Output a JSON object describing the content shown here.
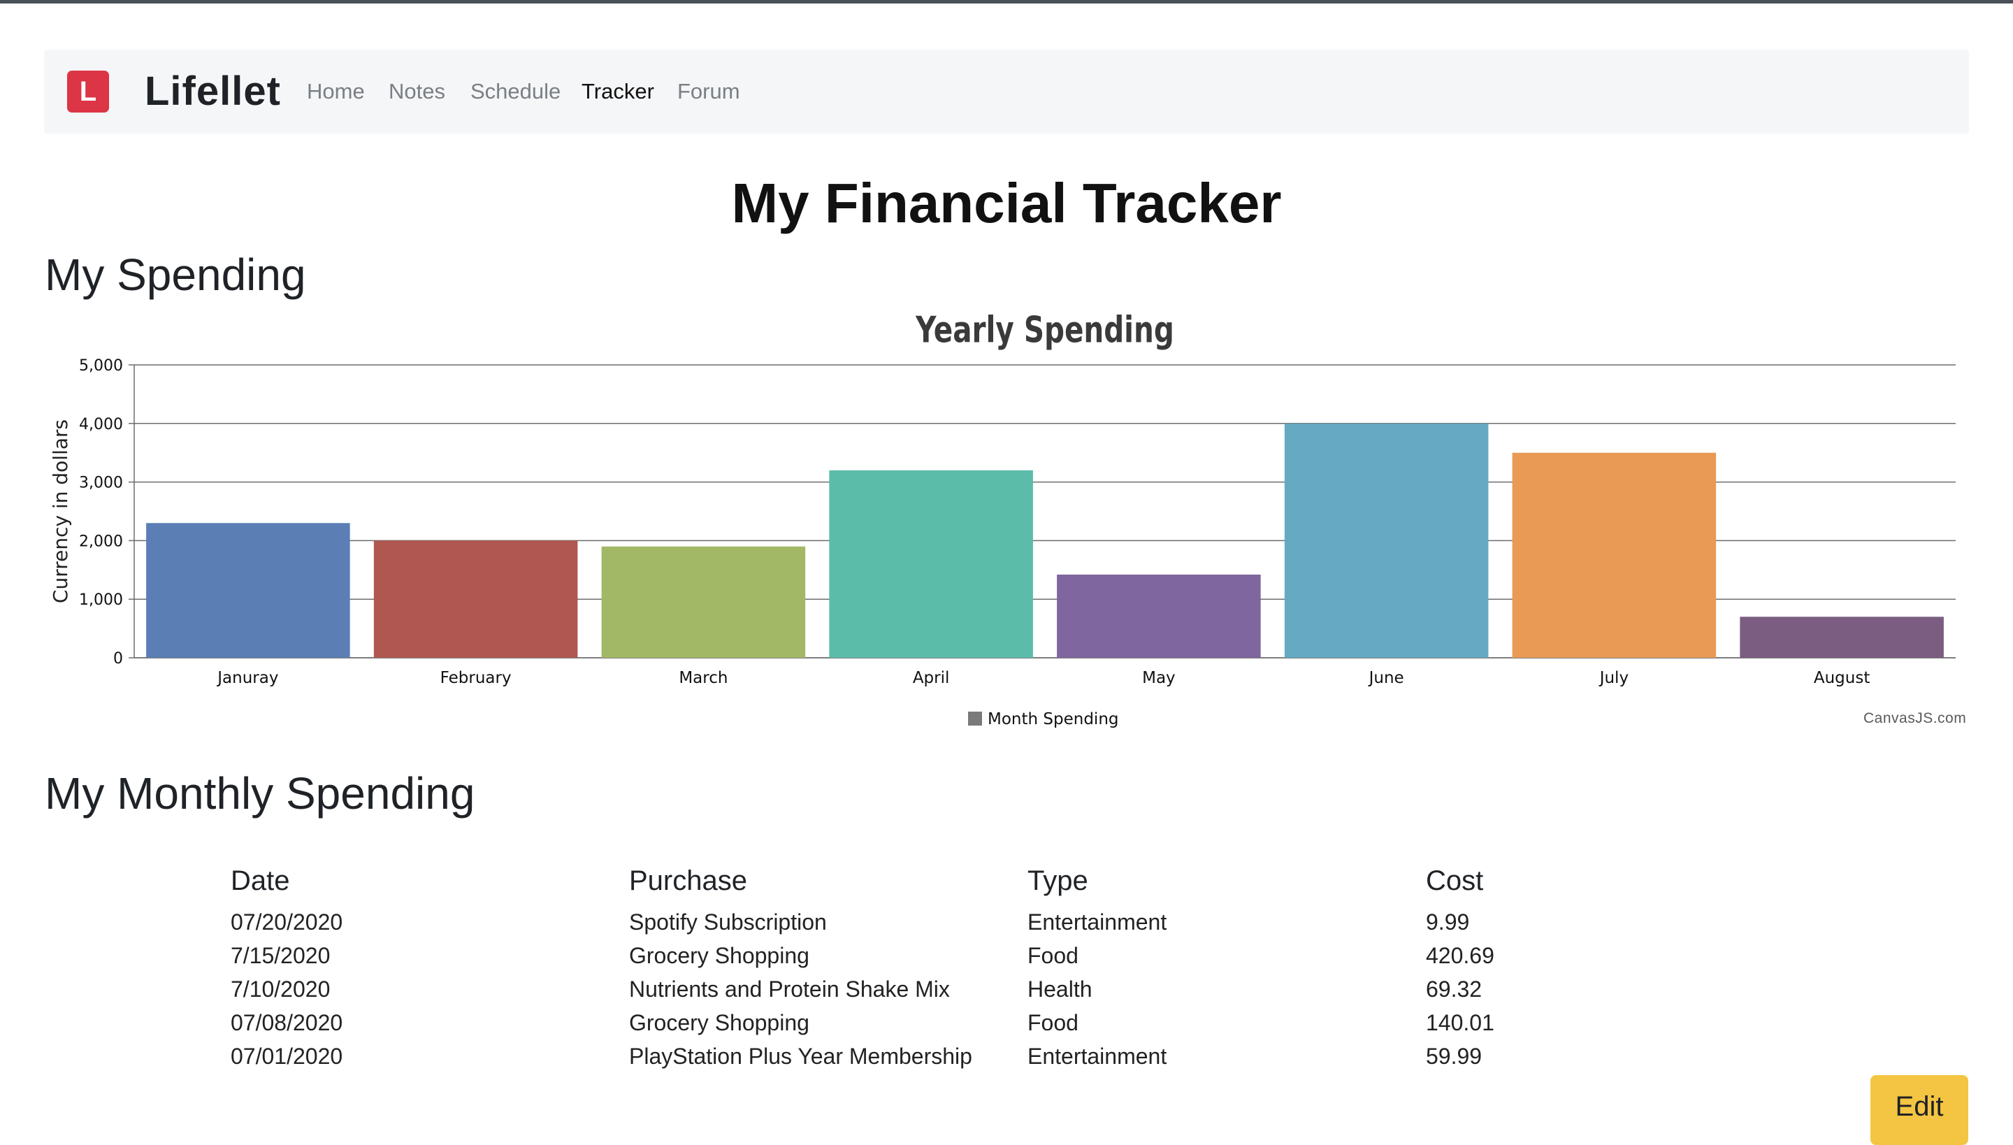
{
  "nav": {
    "logo_letter": "L",
    "brand": "Lifellet",
    "links": [
      "Home",
      "Notes",
      "Schedule",
      "Tracker",
      "Forum"
    ],
    "active": "Tracker"
  },
  "page": {
    "title": "My Financial Tracker",
    "spending_heading": "My Spending",
    "monthly_heading": "My Monthly Spending",
    "edit_label": "Edit"
  },
  "chart_data": {
    "type": "bar",
    "title": "Yearly Spending",
    "ylabel": "Currency in dollars",
    "xlabel": "",
    "categories": [
      "Januray",
      "February",
      "March",
      "April",
      "May",
      "June",
      "July",
      "August"
    ],
    "series": [
      {
        "name": "Month Spending",
        "values": [
          2300,
          2000,
          1900,
          3200,
          1420,
          4000,
          3500,
          700
        ]
      }
    ],
    "colors": [
      "#5b7fb5",
      "#b05751",
      "#a3b866",
      "#5bbca9",
      "#7f669e",
      "#66a9c3",
      "#e99a55",
      "#7a5d80"
    ],
    "ylim": [
      0,
      5000
    ],
    "yticks": [
      "0",
      "1,000",
      "2,000",
      "3,000",
      "4,000",
      "5,000"
    ],
    "grid": true,
    "legend": "bottom-center",
    "credit": "CanvasJS.com"
  },
  "table": {
    "headers": [
      "Date",
      "Purchase",
      "Type",
      "Cost"
    ],
    "rows": [
      [
        "07/20/2020",
        "Spotify Subscription",
        "Entertainment",
        "9.99"
      ],
      [
        "7/15/2020",
        "Grocery Shopping",
        "Food",
        "420.69"
      ],
      [
        "7/10/2020",
        "Nutrients and Protein Shake Mix",
        "Health",
        "69.32"
      ],
      [
        "07/08/2020",
        "Grocery Shopping",
        "Food",
        "140.01"
      ],
      [
        "07/01/2020",
        "PlayStation Plus Year Membership",
        "Entertainment",
        "59.99"
      ]
    ]
  }
}
